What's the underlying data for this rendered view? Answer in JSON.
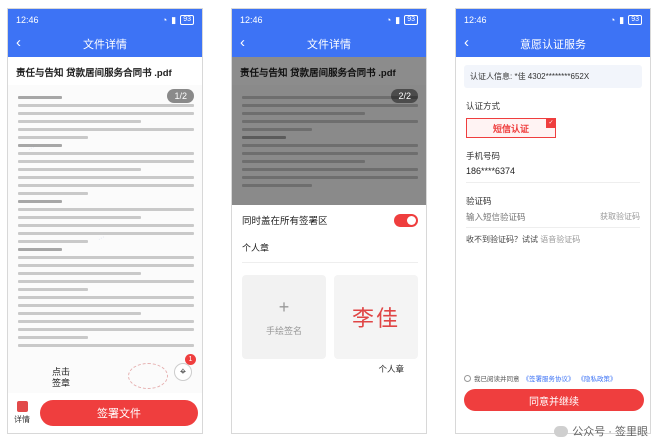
{
  "status": {
    "time": "12:46",
    "battery": "93"
  },
  "screen1": {
    "title": "文件详情",
    "doc_title": "责任与告知 贷款居间服务合同书 .pdf",
    "pager": "1/2",
    "click_tip": "点击",
    "click_tip2": "签章",
    "badge": "1",
    "grid_label": "详情",
    "sign_button": "签署文件"
  },
  "screen2": {
    "title": "文件详情",
    "doc_title": "责任与告知 贷款居间服务合同书 .pdf",
    "pager": "2/2",
    "toggle_label": "同时盖在所有签署区",
    "seal_section": "个人章",
    "handwrite_label": "手绘签名",
    "seal_text": "李佳",
    "seal_caption": "个人章"
  },
  "screen3": {
    "title": "意愿认证服务",
    "info_label": "认证人信息:",
    "info_value": "*佳 4302********652X",
    "method_label": "认证方式",
    "method_value": "短信认证",
    "phone_label": "手机号码",
    "phone_value": "186****6374",
    "code_label": "验证码",
    "code_placeholder": "输入短信验证码",
    "get_code": "获取验证码",
    "no_receive": "收不到验证码？试试",
    "voice_code": "语音验证码",
    "agree_prefix": "我已阅读并同意",
    "agree_link1": "《签署服务协议》",
    "agree_link2": "《隐私政策》",
    "submit": "同意并继续",
    "brand": "公众号 · 签里眼"
  },
  "colors": {
    "primary": "#3d73f5",
    "accent": "#ef3e3e"
  }
}
